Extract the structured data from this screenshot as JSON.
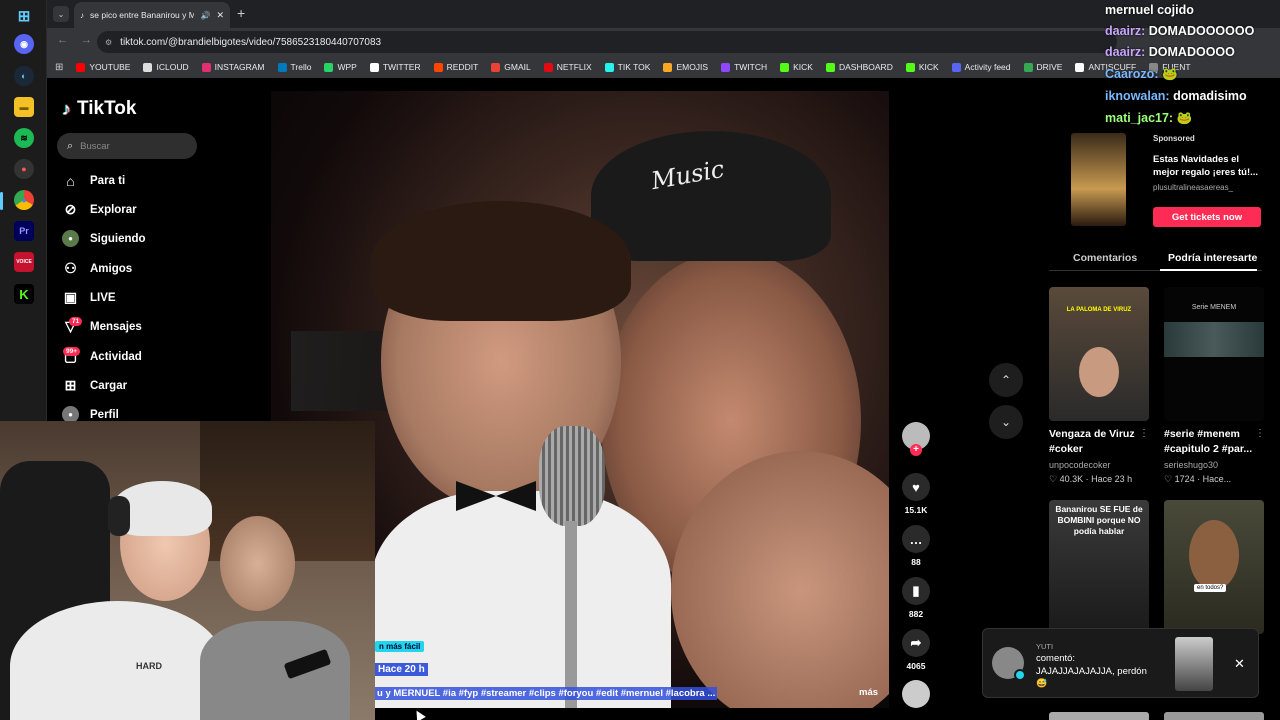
{
  "browser": {
    "tab_title": "se pico entre Bananirou y M",
    "url": "tiktok.com/@brandielbigotes/video/7586523180440707083",
    "bookmarks": [
      {
        "label": "YOUTUBE",
        "color": "#ff0000"
      },
      {
        "label": "ICLOUD",
        "color": "#dddddd"
      },
      {
        "label": "INSTAGRAM",
        "color": "#e1306c"
      },
      {
        "label": "Trello",
        "color": "#0079bf"
      },
      {
        "label": "WPP",
        "color": "#25d366"
      },
      {
        "label": "TWITTER",
        "color": "#ffffff"
      },
      {
        "label": "REDDIT",
        "color": "#ff4500"
      },
      {
        "label": "GMAIL",
        "color": "#ea4335"
      },
      {
        "label": "NETFLIX",
        "color": "#e50914"
      },
      {
        "label": "TIK TOK",
        "color": "#25f4ee"
      },
      {
        "label": "EMOJIS",
        "color": "#f9a825"
      },
      {
        "label": "TWITCH",
        "color": "#9146ff"
      },
      {
        "label": "KICK",
        "color": "#53fc18"
      },
      {
        "label": "DASHBOARD",
        "color": "#53fc18"
      },
      {
        "label": "KICK",
        "color": "#53fc18"
      },
      {
        "label": "Activity feed",
        "color": "#5865f2"
      },
      {
        "label": "DRIVE",
        "color": "#34a853"
      },
      {
        "label": "ANTISCUFF",
        "color": "#ffffff"
      },
      {
        "label": "FUENT",
        "color": "#888888"
      }
    ]
  },
  "tiktok": {
    "logo": "TikTok",
    "search_placeholder": "Buscar",
    "nav": {
      "for_you": "Para ti",
      "explore": "Explorar",
      "following": "Siguiendo",
      "friends": "Amigos",
      "live": "LIVE",
      "messages": "Mensajes",
      "messages_badge": "71",
      "activity": "Actividad",
      "activity_badge": "99+",
      "upload": "Cargar",
      "profile": "Perfil"
    },
    "video": {
      "tag_label": "n más fácil",
      "time_label": "Hace 20 h",
      "caption": "u y MERNUEL #ia #fyp #streamer #clips #foryou #edit #mernuel #lacobra ...",
      "more": "más",
      "cap_text": "Music"
    },
    "actions": {
      "likes": "15.1K",
      "comments": "88",
      "saves": "882",
      "shares": "4065"
    }
  },
  "right_panel": {
    "sponsored": "Sponsored",
    "ad_title": "Estas Navidades el mejor regalo ¡eres tú!...",
    "ad_account": "plusultralineasaereas_",
    "ad_cta": "Get tickets now",
    "tab_comments": "Comentarios",
    "tab_related": "Podría interesarte",
    "recommended": [
      {
        "title": "Vengaza de Viruz #coker",
        "author": "unpocodecoker",
        "stats": "40.3K · Hace 23 h",
        "thumb_text": "LA PALOMA DE VIRUZ"
      },
      {
        "title": "#serie #menem #capitulo 2 #par...",
        "author": "serieshugo30",
        "stats": "1724 · Hace...",
        "thumb_text": "Serie MENEM"
      },
      {
        "title": "",
        "author": "",
        "stats": "",
        "thumb_text": "Bananirou SE FUE de BOMBINI porque NO podía hablar"
      },
      {
        "title": "",
        "author": "",
        "stats": "",
        "thumb_text": "en todos?"
      }
    ]
  },
  "chat": [
    {
      "user": "mernuel cojido",
      "user_color": "#ffffff",
      "message": ""
    },
    {
      "user": "daairz:",
      "user_color": "#c9a7ff",
      "message": "DOMADOOOOOO"
    },
    {
      "user": "daairz:",
      "user_color": "#c9a7ff",
      "message": "DOMADOOOO"
    },
    {
      "user": "Caarozo:",
      "user_color": "#7ab8ff",
      "message": "🐸"
    },
    {
      "user": "iknowalan:",
      "user_color": "#7ab8ff",
      "message": "domadisimo"
    },
    {
      "user": "mati_jac17:",
      "user_color": "#9dff7a",
      "message": "🐸"
    }
  ],
  "notification": {
    "user": "YUTI",
    "line1": "comentó:",
    "line2": "JAJAJJAJAJAJJA, perdón",
    "emoji": "😅"
  },
  "colors": {
    "tiktok_red": "#fe2c55",
    "chrome_bg": "#35363a"
  }
}
